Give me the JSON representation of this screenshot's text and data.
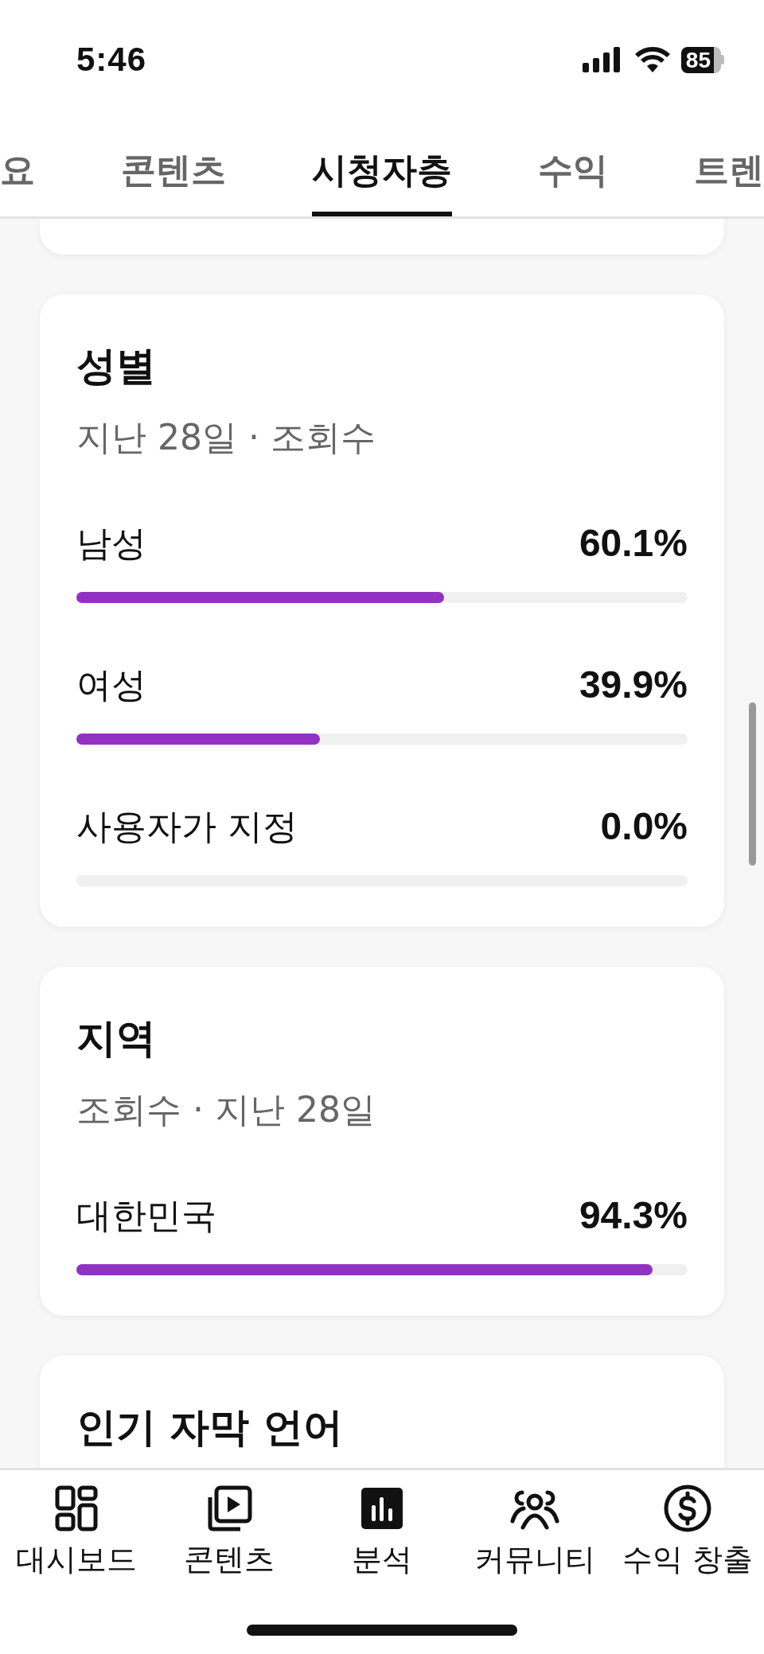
{
  "status_bar": {
    "time": "5:46",
    "battery": "85"
  },
  "tabs": [
    {
      "label": "요",
      "selected": false
    },
    {
      "label": "콘텐츠",
      "selected": false
    },
    {
      "label": "시청자층",
      "selected": true
    },
    {
      "label": "수익",
      "selected": false
    },
    {
      "label": "트렌",
      "selected": false
    }
  ],
  "cards": [
    {
      "title": "성별",
      "subtitle": "지난 28일 · 조회수",
      "rows": [
        {
          "label": "남성",
          "value": "60.1%",
          "level": 0.601
        },
        {
          "label": "여성",
          "value": "39.9%",
          "level": 0.399
        },
        {
          "label": "사용자가 지정",
          "value": "0.0%",
          "level": 0.0
        }
      ]
    },
    {
      "title": "지역",
      "subtitle": "조회수 · 지난 28일",
      "rows": [
        {
          "label": "대한민국",
          "value": "94.3%",
          "level": 0.943
        }
      ]
    },
    {
      "title": "인기 자막 언어"
    }
  ],
  "nav": [
    {
      "label": "대시보드",
      "kind": "dashboard",
      "selected": false
    },
    {
      "label": "콘텐츠",
      "kind": "content",
      "selected": false
    },
    {
      "label": "분석",
      "kind": "analytics",
      "selected": true
    },
    {
      "label": "커뮤니티",
      "kind": "community",
      "selected": false
    },
    {
      "label": "수익 창출",
      "kind": "money",
      "selected": false
    }
  ]
}
